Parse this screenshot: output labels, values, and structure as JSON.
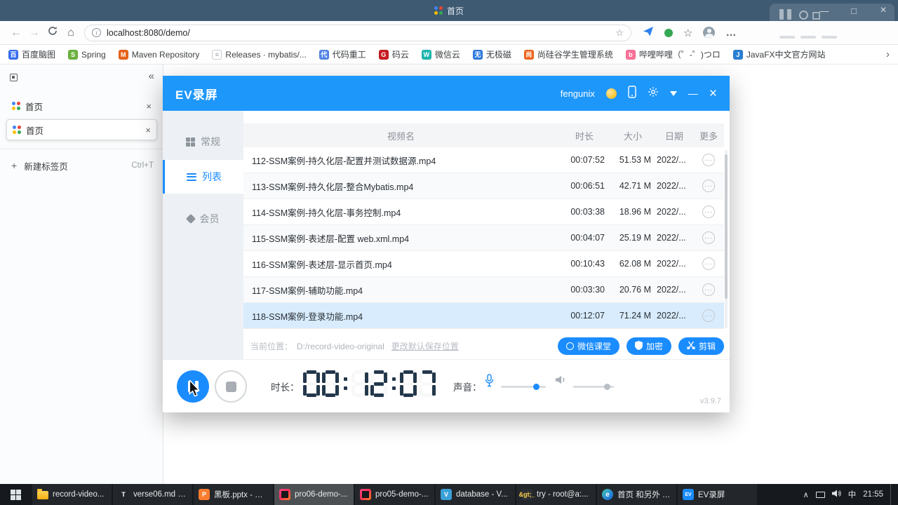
{
  "colors": {
    "accent_blue": "#1a8cfe",
    "ev_titlebar_blue": "#1e97fb",
    "browser_titlebar": "#3e5a72",
    "selected_row_blue": "#d8ecfd",
    "taskbar_black": "#16191d"
  },
  "icons": {
    "more": "···",
    "close": "×",
    "minimize": "—",
    "maximize": "□",
    "back": "←",
    "forward": "→",
    "home": "⌂",
    "star": "☆",
    "info": "i",
    "ellipsis": "…",
    "collapse": "«",
    "plus": "+",
    "chevron_right": "›",
    "tray_up": "∧"
  },
  "browser": {
    "title": "首页",
    "url": "localhost:8080/demo/",
    "bookmarks": [
      {
        "label": "百度脑图",
        "icon_text": "百",
        "icon_bg": "#3a6ff2",
        "icon_fg": "#ffffff"
      },
      {
        "label": "Spring",
        "icon_text": "S",
        "icon_bg": "#6db33f",
        "icon_fg": "#ffffff"
      },
      {
        "label": "Maven Repository",
        "icon_text": "M",
        "icon_bg": "#e8641b",
        "icon_fg": "#ffffff"
      },
      {
        "label": "Releases · mybatis/...",
        "icon_text": "≡",
        "icon_bg": "#ffffff",
        "icon_fg": "#9aa0a6"
      },
      {
        "label": "代码重工",
        "icon_text": "代",
        "icon_bg": "#5586ea",
        "icon_fg": "#ffffff"
      },
      {
        "label": "码云",
        "icon_text": "G",
        "icon_bg": "#c71d23",
        "icon_fg": "#ffffff"
      },
      {
        "label": "微信云",
        "icon_text": "W",
        "icon_bg": "#1fb6b0",
        "icon_fg": "#ffffff"
      },
      {
        "label": "无极磁",
        "icon_text": "无",
        "icon_bg": "#2e7ce0",
        "icon_fg": "#ffffff"
      },
      {
        "label": "尚硅谷学生管理系统",
        "icon_text": "尚",
        "icon_bg": "#f2671f",
        "icon_fg": "#ffffff"
      },
      {
        "label": "哔哩哔哩（゜-゜)つロ",
        "icon_text": "b",
        "icon_bg": "#fb7299",
        "icon_fg": "#ffffff"
      },
      {
        "label": "JavaFX中文官方网站",
        "icon_text": "J",
        "icon_bg": "#2a7fd4",
        "icon_fg": "#ffffff"
      }
    ],
    "sidebar": {
      "tabs": [
        {
          "label": "首页"
        },
        {
          "label": "首页"
        }
      ],
      "new_tab_label": "新建标签页",
      "new_tab_shortcut": "Ctrl+T"
    }
  },
  "ev": {
    "title": "EV录屏",
    "user": "fengunix",
    "nav": [
      {
        "label": "常规"
      },
      {
        "label": "列表"
      },
      {
        "label": "会员"
      }
    ],
    "table": {
      "headers": [
        "视频名",
        "时长",
        "大小",
        "日期",
        "更多"
      ],
      "rows": [
        {
          "name": "112-SSM案例-持久化层-配置并测试数据源.mp4",
          "duration": "00:07:52",
          "size": "51.53 M",
          "date": "2022/..."
        },
        {
          "name": "113-SSM案例-持久化层-整合Mybatis.mp4",
          "duration": "00:06:51",
          "size": "42.71 M",
          "date": "2022/..."
        },
        {
          "name": "114-SSM案例-持久化层-事务控制.mp4",
          "duration": "00:03:38",
          "size": "18.96 M",
          "date": "2022/..."
        },
        {
          "name": "115-SSM案例-表述层-配置 web.xml.mp4",
          "duration": "00:04:07",
          "size": "25.19 M",
          "date": "2022/..."
        },
        {
          "name": "116-SSM案例-表述层-显示首页.mp4",
          "duration": "00:10:43",
          "size": "62.08 M",
          "date": "2022/..."
        },
        {
          "name": "117-SSM案例-辅助功能.mp4",
          "duration": "00:03:30",
          "size": "20.76 M",
          "date": "2022/..."
        },
        {
          "name": "118-SSM案例-登录功能.mp4",
          "duration": "00:12:07",
          "size": "71.24 M",
          "date": "2022/..."
        }
      ]
    },
    "status": {
      "prefix": "当前位置：",
      "path": "D:/record-video-original",
      "change_link": "更改默认保存位置"
    },
    "actions": [
      {
        "label": "微信课堂"
      },
      {
        "label": "加密"
      },
      {
        "label": "剪辑"
      }
    ],
    "footer": {
      "duration_label": "时长：",
      "time": "00:12:07",
      "sound_label": "声音：",
      "version": "v3.9.7"
    }
  },
  "taskbar": {
    "items": [
      {
        "label": "record-video...",
        "icon_text": "",
        "icon_bg": "",
        "icon_fg": ""
      },
      {
        "label": "verse06.md - ...",
        "icon_text": "T",
        "icon_bg": "#22262b",
        "icon_fg": "#ffffff"
      },
      {
        "label": "黑板.pptx - W...",
        "icon_text": "P",
        "icon_bg": "#f97c2f",
        "icon_fg": "#ffffff"
      },
      {
        "label": "pro06-demo-...",
        "icon_text": "",
        "icon_bg": "",
        "icon_fg": ""
      },
      {
        "label": "pro05-demo-...",
        "icon_text": "",
        "icon_bg": "",
        "icon_fg": ""
      },
      {
        "label": "database - V...",
        "icon_text": "V",
        "icon_bg": "#3aa0d8",
        "icon_fg": "#ffffff"
      },
      {
        "label": "try - root@a:...",
        "icon_text": "&gt;_",
        "icon_bg": "#2b2f33",
        "icon_fg": "#ffd24d"
      },
      {
        "label": "首页 和另外 1...",
        "icon_text": "e",
        "icon_bg": "",
        "icon_fg": "#ffffff"
      },
      {
        "label": "EV录屏",
        "icon_text": "EV",
        "icon_bg": "#1a8cfe",
        "icon_fg": "#ffffff"
      }
    ],
    "tray": {
      "ime": "中",
      "time": "21:55"
    }
  }
}
